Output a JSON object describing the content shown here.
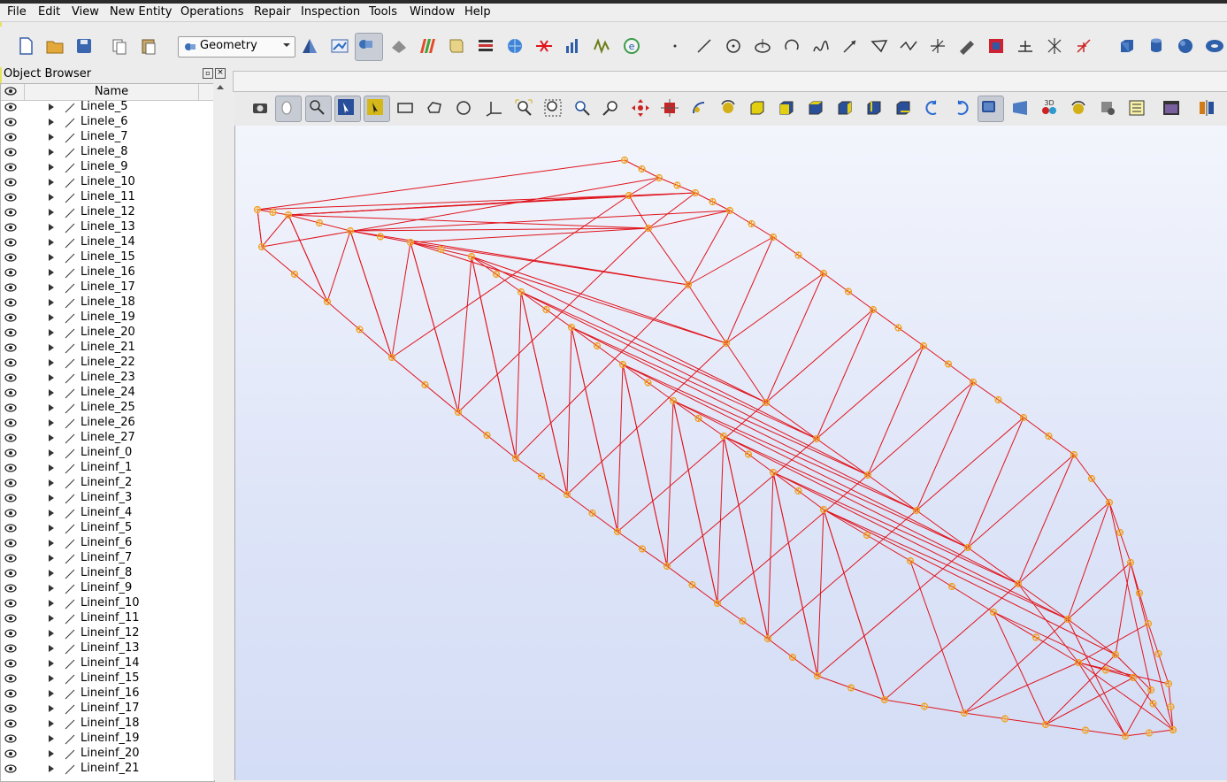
{
  "menubar": {
    "items": [
      "File",
      "Edit",
      "View",
      "New Entity",
      "Operations",
      "Repair",
      "Inspection",
      "Tools",
      "Window",
      "Help"
    ]
  },
  "module_selector": {
    "value": "Geometry",
    "icon": "geometry-module-icon"
  },
  "object_browser": {
    "title": "Object Browser",
    "column_name": "Name",
    "items": [
      "Linele_5",
      "Linele_6",
      "Linele_7",
      "Linele_8",
      "Linele_9",
      "Linele_10",
      "Linele_11",
      "Linele_12",
      "Linele_13",
      "Linele_14",
      "Linele_15",
      "Linele_16",
      "Linele_17",
      "Linele_18",
      "Linele_19",
      "Linele_20",
      "Linele_21",
      "Linele_22",
      "Linele_23",
      "Linele_24",
      "Linele_25",
      "Linele_26",
      "Linele_27",
      "Lineinf_0",
      "Lineinf_1",
      "Lineinf_2",
      "Lineinf_3",
      "Lineinf_4",
      "Lineinf_5",
      "Lineinf_6",
      "Lineinf_7",
      "Lineinf_8",
      "Lineinf_9",
      "Lineinf_10",
      "Lineinf_11",
      "Lineinf_12",
      "Lineinf_13",
      "Lineinf_14",
      "Lineinf_15",
      "Lineinf_16",
      "Lineinf_17",
      "Lineinf_18",
      "Lineinf_19",
      "Lineinf_20",
      "Lineinf_21"
    ]
  },
  "colors": {
    "wireframe": "#e0141c",
    "vertex": "#f0a020",
    "viewport_top": "#f3f5fc",
    "viewport_bottom": "#d4ddf6"
  }
}
